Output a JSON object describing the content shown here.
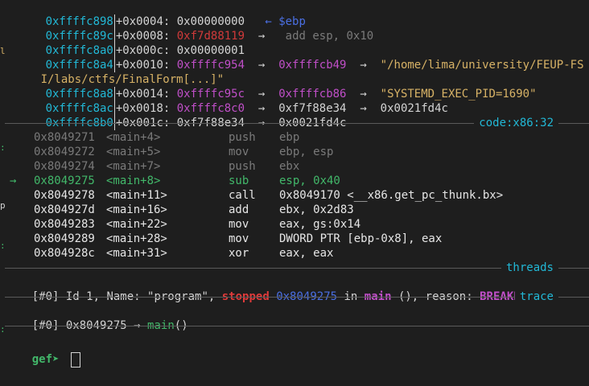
{
  "stack": [
    {
      "addr": "0xffffc898",
      "off": "+0x0004:",
      "val": "0x00000000",
      "extra": "← $ebp"
    },
    {
      "addr": "0xffffc89c",
      "off": "+0x0008:",
      "val": "0xf7d88119",
      "arrow": "→",
      "deref": "add esp, 0x10"
    },
    {
      "addr": "0xffffc8a0",
      "off": "+0x000c:",
      "val": "0x00000001"
    },
    {
      "addr": "0xffffc8a4",
      "off": "+0x0010:",
      "val": "0xffffc954",
      "arrow": "→",
      "deref": "0xffffcb49",
      "arrow2": "→",
      "str": "\"/home/lima/university/FEUP-FS"
    },
    {
      "wrap": "I/labs/ctfs/FinalForm[...]\""
    },
    {
      "addr": "0xffffc8a8",
      "off": "+0x0014:",
      "val": "0xffffc95c",
      "arrow": "→",
      "deref": "0xffffcb86",
      "arrow2": "→",
      "str": "\"SYSTEMD_EXEC_PID=1690\""
    },
    {
      "addr": "0xffffc8ac",
      "off": "+0x0018:",
      "val": "0xffffc8c0",
      "arrow": "→",
      "deref": "0xf7f88e34",
      "arrow2": "→",
      "str": "0x0021fd4c"
    },
    {
      "addr": "0xffffc8b0",
      "off": "+0x001c:",
      "val": "0xf7f88e34",
      "arrow": "→",
      "deref": "0x0021fd4c"
    }
  ],
  "code_header": "code:x86:32",
  "code": [
    {
      "marker": "",
      "addr": "0x8049271",
      "sym": "<main+4>",
      "op": "push",
      "args": "ebp"
    },
    {
      "marker": "",
      "addr": "0x8049272",
      "sym": "<main+5>",
      "op": "mov",
      "args": "ebp, esp"
    },
    {
      "marker": "",
      "addr": "0x8049274",
      "sym": "<main+7>",
      "op": "push",
      "args": "ebx"
    },
    {
      "marker": "→",
      "addr": "0x8049275",
      "sym": "<main+8>",
      "op": "sub",
      "args": "esp, 0x40"
    },
    {
      "marker": "",
      "addr": "0x8049278",
      "sym": "<main+11>",
      "op": "call",
      "args": "0x8049170 <__x86.get_pc_thunk.bx>"
    },
    {
      "marker": "",
      "addr": "0x804927d",
      "sym": "<main+16>",
      "op": "add",
      "args": "ebx, 0x2d83"
    },
    {
      "marker": "",
      "addr": "0x8049283",
      "sym": "<main+22>",
      "op": "mov",
      "args": "eax, gs:0x14"
    },
    {
      "marker": "",
      "addr": "0x8049289",
      "sym": "<main+28>",
      "op": "mov",
      "args": "DWORD PTR [ebp-0x8], eax"
    },
    {
      "marker": "",
      "addr": "0x804928c",
      "sym": "<main+31>",
      "op": "xor",
      "args": "eax, eax"
    }
  ],
  "threads_header": "threads",
  "thread": {
    "id": "[#0]",
    "pre": "Id 1, Name: \"program\",",
    "state": "stopped",
    "addr": "0x8049275",
    "in": "in",
    "func": "main",
    "rest": "(), reason:",
    "reason": "BREAKPOINT"
  },
  "trace_header": "trace",
  "trace": {
    "id": "[#0]",
    "addr": "0x8049275",
    "arrow": "→",
    "func": "main",
    "parens": "()"
  },
  "prompt": "gef➤ ",
  "colors": {
    "address": "#22b8d6",
    "pointer": "#c04fc8",
    "string": "#d7b266",
    "code_ptr": "#d03a3a",
    "current": "#42b86a",
    "stopped": "#e03a3a",
    "background": "#1e1e1e"
  }
}
